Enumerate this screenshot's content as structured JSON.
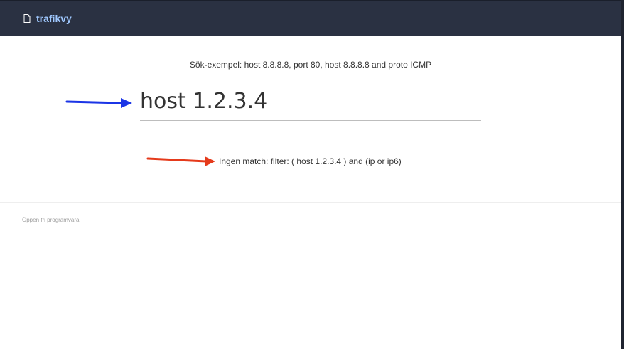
{
  "app": {
    "title": "trafikvy",
    "icon": "document-icon"
  },
  "search": {
    "hint": "Sök-exempel: host 8.8.8.8, port 80, host 8.8.8.8 and proto ICMP",
    "value": "host 1.2.3.4"
  },
  "result": {
    "message": "Ingen match: filter: ( host 1.2.3.4 ) and (ip or ip6)"
  },
  "footer": {
    "text": "Öppen fri programvara"
  },
  "colors": {
    "topbar": "#2a3142",
    "brand": "#9fc8ff",
    "arrow_blue": "#1b35e6",
    "arrow_red": "#e53a1b"
  }
}
